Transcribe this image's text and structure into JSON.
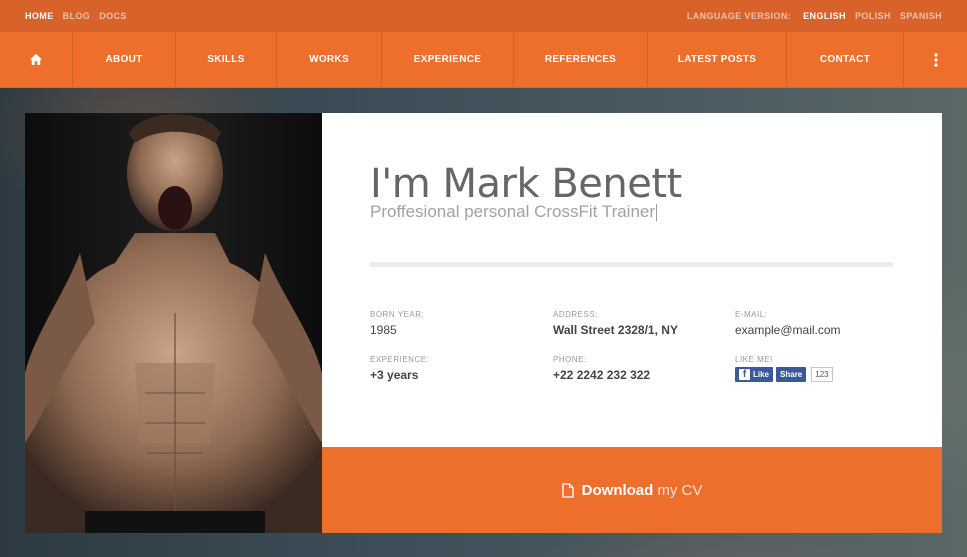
{
  "topbar": {
    "links": [
      "HOME",
      "BLOG",
      "DOCS"
    ],
    "language_label": "LANGUAGE VERSION:",
    "languages": [
      "ENGLISH",
      "POLISH",
      "SPANISH"
    ]
  },
  "nav": {
    "home_icon": "home-icon",
    "items": [
      "ABOUT",
      "SKILLS",
      "WORKS",
      "EXPERIENCE",
      "REFERENCES",
      "LATEST POSTS",
      "CONTACT"
    ],
    "more_icon": "more-vertical-icon"
  },
  "profile": {
    "name": "I'm Mark Benett",
    "subtitle": "Proffesional personal CrossFit Trainer",
    "born_label": "BORN YEAR:",
    "born_value": "1985",
    "address_label": "ADDRESS:",
    "address_value": "Wall Street 2328/1, NY",
    "email_label": "E-MAIL:",
    "email_value": "example@mail.com",
    "experience_label": "EXPERIENCE:",
    "experience_value": "+3 years",
    "phone_label": "PHONE:",
    "phone_value": "+22 2242 232 322",
    "like_label": "LIKE ME!",
    "like_button": "Like",
    "share_button": "Share",
    "like_count": "123"
  },
  "download": {
    "bold": "Download",
    "light": "my CV",
    "icon": "document-icon"
  },
  "colors": {
    "accent": "#ee6e2c",
    "topbar": "#d8622a",
    "facebook": "#3b5998"
  }
}
